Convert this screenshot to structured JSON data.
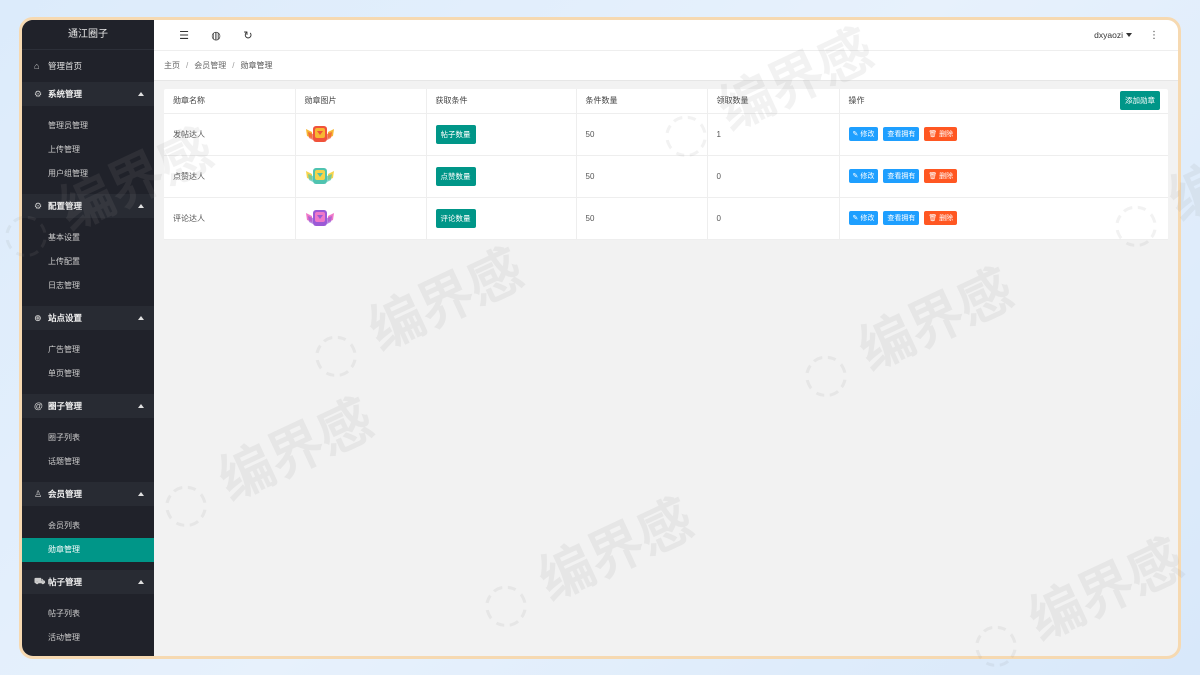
{
  "app_title": "通江圈子",
  "sidebar": {
    "home": "管理首页",
    "groups": [
      {
        "icon": "gear-icon",
        "icon_char": "⚙",
        "label": "系统管理",
        "items": [
          {
            "label": "管理员管理"
          },
          {
            "label": "上传管理"
          },
          {
            "label": "用户组管理"
          }
        ]
      },
      {
        "icon": "gear-icon",
        "icon_char": "⚙",
        "label": "配置管理",
        "items": [
          {
            "label": "基本设置"
          },
          {
            "label": "上传配置"
          },
          {
            "label": "日志管理"
          }
        ]
      },
      {
        "icon": "site-icon",
        "icon_char": "⊕",
        "label": "站点设置",
        "items": [
          {
            "label": "广告管理"
          },
          {
            "label": "单页管理"
          }
        ]
      },
      {
        "icon": "at-icon",
        "icon_char": "@",
        "label": "圈子管理",
        "items": [
          {
            "label": "圈子列表"
          },
          {
            "label": "话题管理"
          }
        ]
      },
      {
        "icon": "user-icon",
        "icon_char": "♙",
        "label": "会员管理",
        "items": [
          {
            "label": "会员列表"
          },
          {
            "label": "勋章管理",
            "active": true
          }
        ]
      },
      {
        "icon": "cart-icon",
        "icon_char": "⛟",
        "label": "帖子管理",
        "items": [
          {
            "label": "帖子列表"
          },
          {
            "label": "活动管理"
          }
        ]
      }
    ]
  },
  "topbar": {
    "username": "dxyaozi"
  },
  "breadcrumb": {
    "home": "主页",
    "parent": "会员管理",
    "current": "勋章管理"
  },
  "table": {
    "headers": [
      "勋章名称",
      "勋章图片",
      "获取条件",
      "条件数量",
      "领取数量",
      "操作"
    ],
    "add_button": "添加勋章",
    "op_labels": {
      "edit": "修改",
      "view": "查看拥有",
      "delete": "删除"
    },
    "rows": [
      {
        "name": "发帖达人",
        "condition": "帖子数量",
        "cond_count": "50",
        "claimed": "1",
        "badge_color": "#f0523b",
        "badge_accent": "#f7b733"
      },
      {
        "name": "点赞达人",
        "condition": "点赞数量",
        "cond_count": "50",
        "claimed": "0",
        "badge_color": "#4fc3b0",
        "badge_accent": "#f7d44a"
      },
      {
        "name": "评论达人",
        "condition": "评论数量",
        "cond_count": "50",
        "claimed": "0",
        "badge_color": "#9b59d6",
        "badge_accent": "#f078c8"
      }
    ]
  },
  "watermark_text": "编界感",
  "colors": {
    "accent": "#009688",
    "blue": "#1e9fff",
    "danger": "#ff5722",
    "sidebar_bg": "#20222a"
  }
}
